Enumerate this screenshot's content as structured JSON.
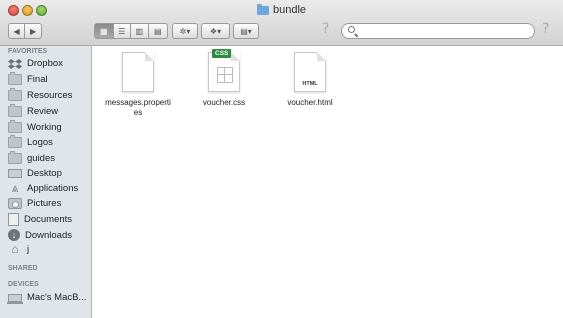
{
  "window": {
    "title": "bundle"
  },
  "toolbar": {
    "nav_back_icon": "chevron-left-icon",
    "nav_forward_icon": "chevron-right-icon",
    "view_icons": [
      "icon-view-icon",
      "list-view-icon",
      "column-view-icon",
      "coverflow-view-icon"
    ],
    "action_icon": "gear-icon",
    "dropbox_icon": "dropbox-icon",
    "arrange_icon": "arrange-icon",
    "help_label": "?",
    "search_placeholder": ""
  },
  "sidebar": {
    "favorites_title": "FAVORITES",
    "favorites": [
      {
        "label": "Dropbox",
        "icon": "dropbox-icon"
      },
      {
        "label": "Final",
        "icon": "folder-icon"
      },
      {
        "label": "Resources",
        "icon": "folder-icon"
      },
      {
        "label": "Review",
        "icon": "folder-icon"
      },
      {
        "label": "Working",
        "icon": "folder-icon"
      },
      {
        "label": "Logos",
        "icon": "folder-icon"
      },
      {
        "label": "guides",
        "icon": "folder-icon"
      },
      {
        "label": "Desktop",
        "icon": "desktop-icon"
      },
      {
        "label": "Applications",
        "icon": "applications-icon"
      },
      {
        "label": "Pictures",
        "icon": "pictures-icon"
      },
      {
        "label": "Documents",
        "icon": "documents-icon"
      },
      {
        "label": "Downloads",
        "icon": "downloads-icon"
      },
      {
        "label": "j",
        "icon": "home-icon"
      }
    ],
    "shared_title": "SHARED",
    "devices_title": "DEVICES",
    "devices": [
      {
        "label": "Mac's MacB...",
        "icon": "laptop-icon"
      }
    ]
  },
  "files": [
    {
      "name": "messages.properti es",
      "icon": "document-icon",
      "badge": ""
    },
    {
      "name": "voucher.css",
      "icon": "css-file-icon",
      "badge": "CSS"
    },
    {
      "name": "voucher.html",
      "icon": "html-file-icon",
      "badge": "HTML"
    }
  ]
}
